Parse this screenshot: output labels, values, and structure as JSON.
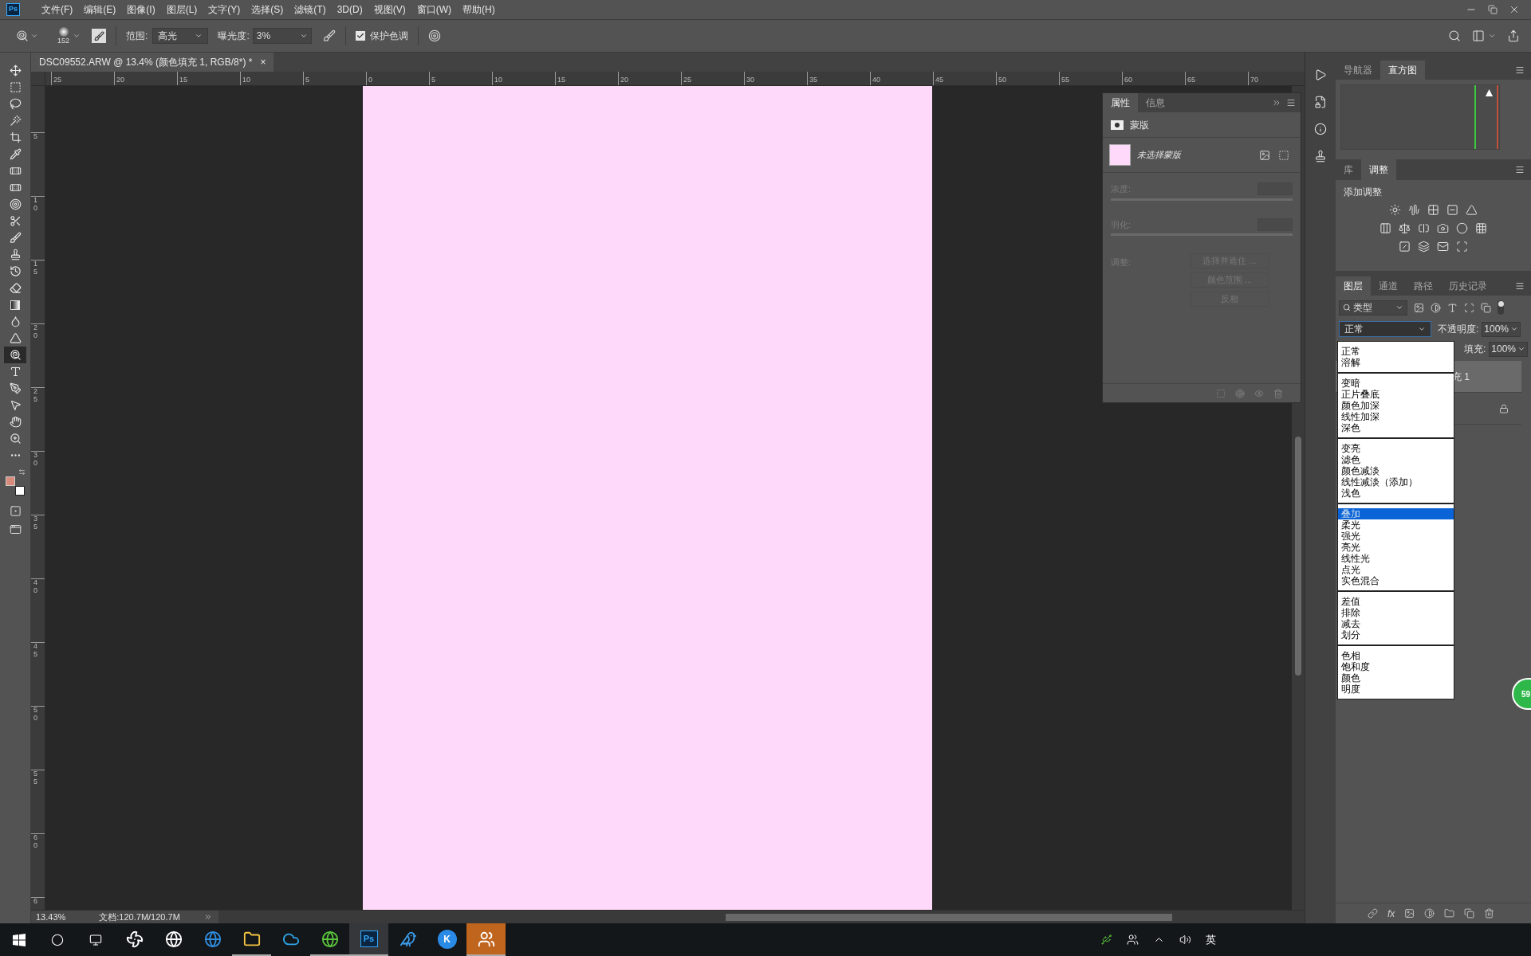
{
  "app_logo": "Ps",
  "menu": [
    "文件(F)",
    "编辑(E)",
    "图像(I)",
    "图层(L)",
    "文字(Y)",
    "选择(S)",
    "滤镜(T)",
    "3D(D)",
    "视图(V)",
    "窗口(W)",
    "帮助(H)"
  ],
  "options": {
    "brush_size": "152",
    "range_label": "范围:",
    "range_value": "高光",
    "exposure_label": "曝光度:",
    "exposure_value": "3%",
    "protect": {
      "label": "保护色调",
      "checked": true
    }
  },
  "document_tab": {
    "title": "DSC09552.ARW @ 13.4% (颜色填充 1, RGB/8*) *",
    "close": "×"
  },
  "ruler_h": [
    "25",
    "20",
    "15",
    "10",
    "5",
    "0",
    "5",
    "10",
    "15",
    "20",
    "25",
    "30",
    "35",
    "40",
    "45",
    "50",
    "55",
    "60",
    "65",
    "70"
  ],
  "ruler_v": [
    "5",
    "10",
    "15",
    "20",
    "25",
    "30",
    "35",
    "40",
    "45",
    "50",
    "55",
    "60",
    "6"
  ],
  "tools": [
    {
      "kind": "move",
      "selected": false
    },
    {
      "kind": "marquee",
      "selected": false
    },
    {
      "kind": "lasso",
      "selected": false
    },
    {
      "kind": "wand",
      "selected": false
    },
    {
      "kind": "crop",
      "selected": false
    },
    {
      "kind": "eyedropper",
      "selected": false
    },
    {
      "kind": "bandage",
      "selected": false
    },
    {
      "kind": "bandage",
      "selected": false
    },
    {
      "kind": "target",
      "selected": false
    },
    {
      "kind": "scissors",
      "selected": false
    },
    {
      "kind": "brush",
      "selected": false
    },
    {
      "kind": "stamp",
      "selected": false
    },
    {
      "kind": "history",
      "selected": false
    },
    {
      "kind": "eraser",
      "selected": false
    },
    {
      "kind": "gradient",
      "selected": false
    },
    {
      "kind": "blur",
      "selected": false
    },
    {
      "kind": "sharpen",
      "selected": false
    },
    {
      "kind": "dodge",
      "selected": true
    },
    {
      "kind": "type",
      "selected": false
    },
    {
      "kind": "pen",
      "selected": false
    },
    {
      "kind": "pointer",
      "selected": false
    },
    {
      "kind": "hand",
      "selected": false
    },
    {
      "kind": "zoom",
      "selected": false
    },
    {
      "kind": "more",
      "selected": false
    }
  ],
  "swatches": [
    {
      "color": "#d98c7c"
    },
    {
      "color": "#ffffff"
    }
  ],
  "properties": {
    "tabs": [
      {
        "label": "属性",
        "selected": true
      },
      {
        "label": "信息",
        "selected": false
      }
    ],
    "section": "蒙版",
    "mask_label": "未选择蒙版",
    "density": {
      "label": "浓度:",
      "level": 0
    },
    "feather": {
      "label": "羽化:",
      "level": 0
    },
    "adjust_label": "调整:",
    "buttons": [
      {
        "label": "选择并遮住 ...",
        "disabled": true
      },
      {
        "label": "颜色范围 ...",
        "disabled": true
      },
      {
        "label": "反相",
        "disabled": true
      }
    ]
  },
  "navigator_tabs": [
    {
      "label": "导航器",
      "selected": false
    },
    {
      "label": "直方图",
      "selected": true
    }
  ],
  "adjust_tabs": [
    {
      "label": "库",
      "selected": false
    },
    {
      "label": "调整",
      "selected": true
    }
  ],
  "adjust_title": "添加调整",
  "layers": {
    "tabs": [
      {
        "label": "图层",
        "selected": true
      },
      {
        "label": "通道",
        "selected": false
      },
      {
        "label": "路径",
        "selected": false
      },
      {
        "label": "历史记录",
        "selected": false
      }
    ],
    "filter": "类型",
    "blend_mode": "正常",
    "opacity_label": "不透明度:",
    "opacity": "100%",
    "fill_label": "填充:",
    "fill": "100%",
    "rows": [
      {
        "name": "充 1",
        "selected": true,
        "locked": false
      },
      {
        "selected": false,
        "locked": true
      }
    ],
    "footer_fx": "fx"
  },
  "blend_menu": [
    {
      "items": [
        {
          "label": "正常",
          "selected": false
        },
        {
          "label": "溶解",
          "selected": false
        }
      ]
    },
    {
      "items": [
        {
          "label": "变暗",
          "selected": false
        },
        {
          "label": "正片叠底",
          "selected": false
        },
        {
          "label": "颜色加深",
          "selected": false
        },
        {
          "label": "线性加深",
          "selected": false
        },
        {
          "label": "深色",
          "selected": false
        }
      ]
    },
    {
      "items": [
        {
          "label": "变亮",
          "selected": false
        },
        {
          "label": "滤色",
          "selected": false
        },
        {
          "label": "颜色减淡",
          "selected": false
        },
        {
          "label": "线性减淡（添加）",
          "selected": false
        },
        {
          "label": "浅色",
          "selected": false
        }
      ]
    },
    {
      "items": [
        {
          "label": "叠加",
          "selected": true
        },
        {
          "label": "柔光",
          "selected": false
        },
        {
          "label": "强光",
          "selected": false
        },
        {
          "label": "亮光",
          "selected": false
        },
        {
          "label": "线性光",
          "selected": false
        },
        {
          "label": "点光",
          "selected": false
        },
        {
          "label": "实色混合",
          "selected": false
        }
      ]
    },
    {
      "items": [
        {
          "label": "差值",
          "selected": false
        },
        {
          "label": "排除",
          "selected": false
        },
        {
          "label": "减去",
          "selected": false
        },
        {
          "label": "划分",
          "selected": false
        }
      ]
    },
    {
      "items": [
        {
          "label": "色相",
          "selected": false
        },
        {
          "label": "饱和度",
          "selected": false
        },
        {
          "label": "颜色",
          "selected": false
        },
        {
          "label": "明度",
          "selected": false
        }
      ]
    }
  ],
  "status": {
    "zoom": "13.43%",
    "doc": "文档:120.7M/120.7M"
  },
  "speed_badge": "59",
  "taskbar": {
    "apps": [
      {
        "kind": "pinwheel",
        "running": false,
        "selected": false
      },
      {
        "kind": "ie",
        "running": false,
        "selected": false
      },
      {
        "kind": "edge",
        "running": false,
        "selected": false
      },
      {
        "kind": "folder",
        "running": true,
        "selected": false
      },
      {
        "kind": "cloud",
        "running": false,
        "selected": false
      },
      {
        "kind": "green",
        "running": true,
        "selected": false
      },
      {
        "kind": "ps",
        "label": "Ps",
        "running": true,
        "selected": true
      },
      {
        "kind": "bird",
        "running": false,
        "selected": false
      },
      {
        "kind": "k",
        "label": "K",
        "running": false,
        "selected": false
      },
      {
        "kind": "qq",
        "running": true,
        "selected": false,
        "flashing": true
      }
    ],
    "ime": "英"
  }
}
